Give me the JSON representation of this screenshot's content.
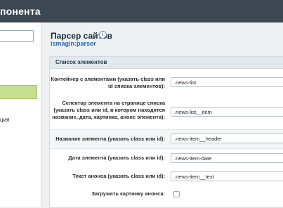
{
  "header": {
    "title": "понента"
  },
  "sidebar": {
    "search_value": "",
    "item_label": "ция"
  },
  "main": {
    "title": "Парсер сайтов",
    "module": "ismagin:parser",
    "info_icon": "i"
  },
  "panel": {
    "title": "Список элементов",
    "rows": [
      {
        "label": "Контейнер с элементами (указать class или id списка элементов):",
        "value": ".news-list"
      },
      {
        "label": "Селектор элемента на странице списка (указать class или id, в котором находятся название, дата, картинка, анонс элемента):",
        "value": ".news-list__item"
      },
      {
        "label": "Название элемента (указать class или id):",
        "value": ".news-item__header"
      },
      {
        "label": "Дата элемента (указать class или id):",
        "value": ".news-item-date"
      },
      {
        "label": "Текст анонса (указать class или id):",
        "value": ".news-item__text"
      },
      {
        "label": "Загружать картинку анонса:",
        "checked": false
      }
    ]
  }
}
